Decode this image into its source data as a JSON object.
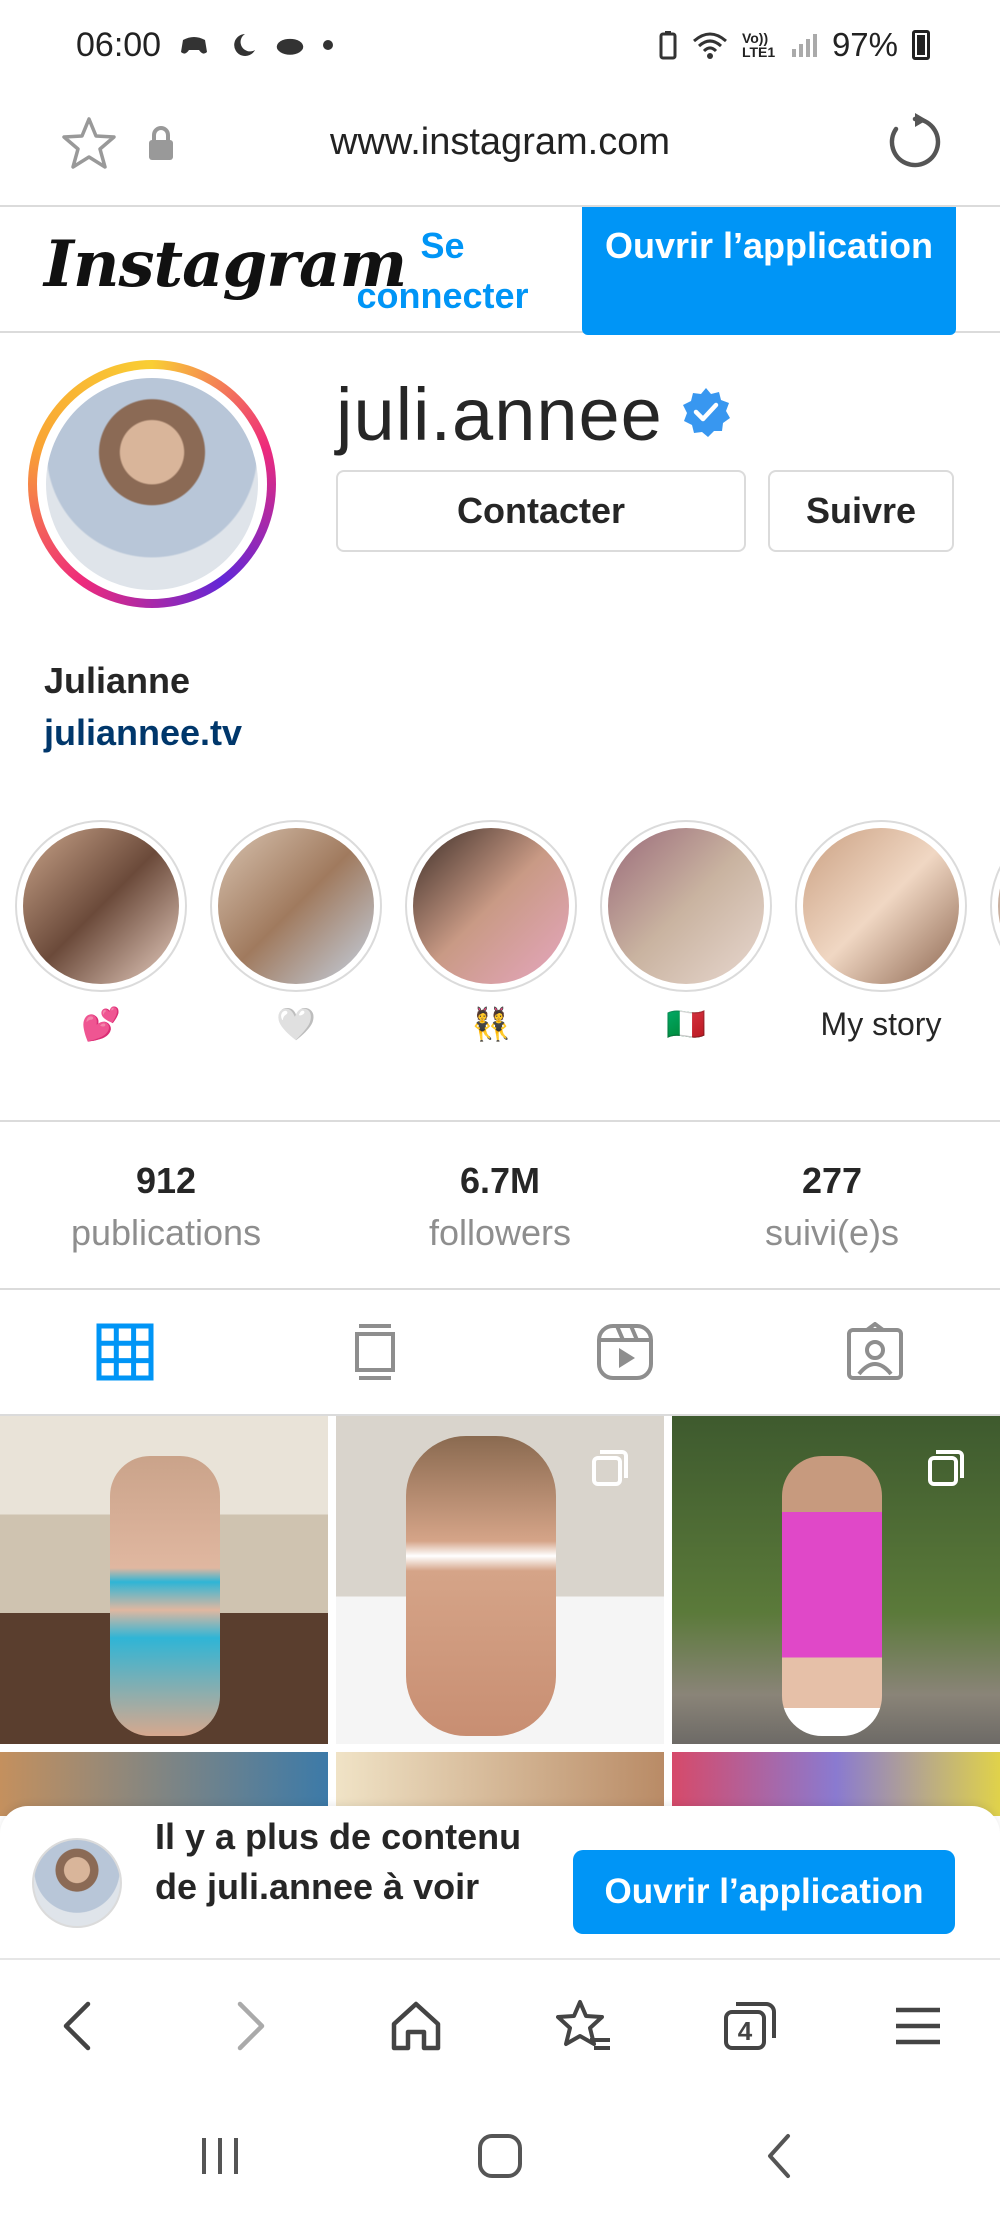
{
  "status_bar": {
    "time": "06:00",
    "battery": "97%",
    "network": "Vo)) LTE1",
    "icons": [
      "game-controller-icon",
      "moon-icon",
      "cloud-icon",
      "dot-icon",
      "battery-saver-icon",
      "wifi-icon",
      "signal-icon",
      "battery-icon"
    ]
  },
  "browser": {
    "url": "www.instagram.com",
    "toolbar_tab_count": "4"
  },
  "header": {
    "logo": "Instagram",
    "login_label": "Se connecter",
    "open_app_label": "Ouvrir l’application",
    "accent_color": "#0095f6"
  },
  "profile": {
    "username": "juli.annee",
    "verified": true,
    "contact_label": "Contacter",
    "follow_label": "Suivre",
    "full_name": "Julianne",
    "website": "juliannee.tv"
  },
  "highlights": [
    {
      "label": "💕"
    },
    {
      "label": "🤍"
    },
    {
      "label": "👯"
    },
    {
      "label": "🇮🇹"
    },
    {
      "label": "My story"
    }
  ],
  "stats": [
    {
      "value": "912",
      "label": "publications"
    },
    {
      "value": "6.7M",
      "label": "followers"
    },
    {
      "value": "277",
      "label": "suivi(e)s"
    }
  ],
  "tabs": [
    "grid-icon",
    "feed-icon",
    "reels-icon",
    "tagged-icon"
  ],
  "banner": {
    "text": "Il y a plus de contenu de juli.annee à voir",
    "button_label": "Ouvrir l’application"
  }
}
